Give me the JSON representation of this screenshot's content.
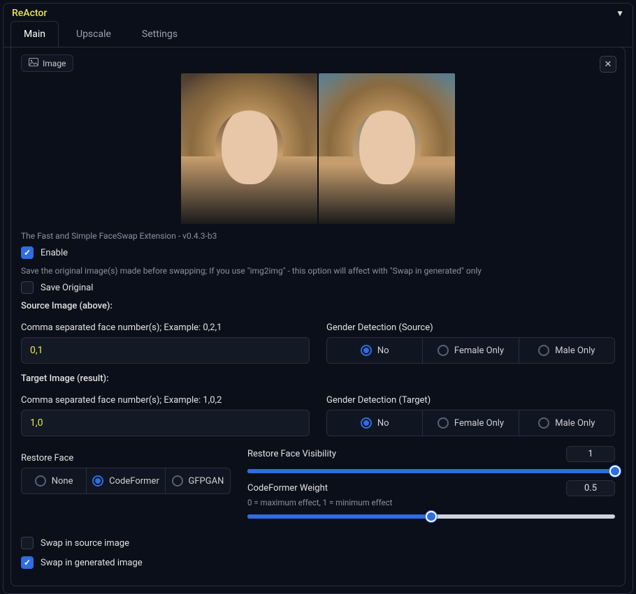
{
  "panel": {
    "title": "ReActor"
  },
  "tabs": [
    {
      "label": "Main",
      "active": true
    },
    {
      "label": "Upscale",
      "active": false
    },
    {
      "label": "Settings",
      "active": false
    }
  ],
  "image_badge": "Image",
  "description": "The Fast and Simple FaceSwap Extension - v0.4.3-b3",
  "enable": {
    "label": "Enable",
    "checked": true
  },
  "save_original": {
    "hint": "Save the original image(s) made before swapping; If you use \"img2img\" - this option will affect with \"Swap in generated\" only",
    "label": "Save Original",
    "checked": false
  },
  "source": {
    "heading": "Source Image (above):",
    "field_label": "Comma separated face number(s); Example: 0,2,1",
    "value": "0,1",
    "gender_label": "Gender Detection (Source)",
    "gender_options": [
      "No",
      "Female Only",
      "Male Only"
    ],
    "gender_selected": "No"
  },
  "target": {
    "heading": "Target Image (result):",
    "field_label": "Comma separated face number(s); Example: 1,0,2",
    "value": "1,0",
    "gender_label": "Gender Detection (Target)",
    "gender_options": [
      "No",
      "Female Only",
      "Male Only"
    ],
    "gender_selected": "No"
  },
  "restore_face": {
    "label": "Restore Face",
    "options": [
      "None",
      "CodeFormer",
      "GFPGAN"
    ],
    "selected": "CodeFormer"
  },
  "visibility": {
    "label": "Restore Face Visibility",
    "value": "1",
    "percent": 100
  },
  "codeformer_weight": {
    "label": "CodeFormer Weight",
    "value": "0.5",
    "hint": "0 = maximum effect, 1 = minimum effect",
    "percent": 50
  },
  "swap_source": {
    "label": "Swap in source image",
    "checked": false
  },
  "swap_generated": {
    "label": "Swap in generated image",
    "checked": true
  }
}
